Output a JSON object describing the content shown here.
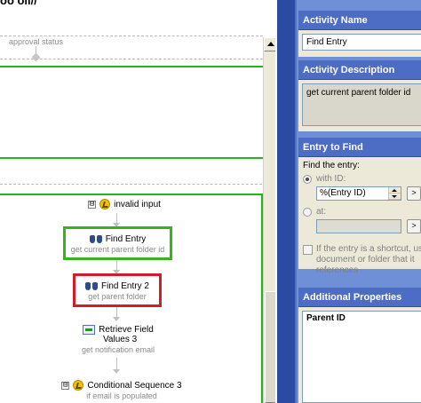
{
  "canvas": {
    "title_fragment": "oo oll//",
    "approval_label": "approval status",
    "nodes": {
      "invalid_input": {
        "title": "invalid input"
      },
      "find_entry": {
        "title": "Find Entry",
        "subtitle": "get current parent folder id"
      },
      "find_entry_2": {
        "title": "Find Entry 2",
        "subtitle": "get parent folder"
      },
      "retrieve_fields": {
        "title_line1": "Retrieve Field",
        "title_line2": "Values 3",
        "subtitle": "get notification email"
      },
      "cond_seq": {
        "title": "Conditional Sequence 3",
        "subtitle": "if email is populated"
      }
    },
    "expander_symbol": "⊟"
  },
  "panel": {
    "activity_name": {
      "header": "Activity Name",
      "value": "Find Entry"
    },
    "activity_description": {
      "header": "Activity Description",
      "value": "get current parent folder id"
    },
    "entry_to_find": {
      "header": "Entry to Find",
      "prompt": "Find the entry:",
      "with_id_label": "with ID:",
      "id_value": "%(Entry ID)",
      "at_label": "at:",
      "browse_label": ">",
      "shortcut_line1": "If the entry is a shortcut, use t",
      "shortcut_line2": "document or folder that it",
      "shortcut_line3": "references"
    },
    "additional_properties": {
      "header": "Additional Properties",
      "prop_title": "Parent ID"
    }
  }
}
